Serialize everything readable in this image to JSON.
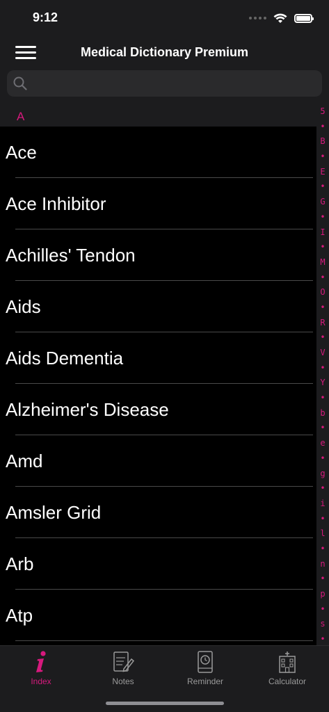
{
  "status_bar": {
    "time": "9:12"
  },
  "nav": {
    "title": "Medical Dictionary Premium"
  },
  "search": {
    "placeholder": "",
    "value": ""
  },
  "section": {
    "letter": "A"
  },
  "entries": [
    "Ace",
    "Ace Inhibitor",
    "Achilles' Tendon",
    "Aids",
    "Aids Dementia",
    "Alzheimer's Disease",
    "Amd",
    "Amsler Grid",
    "Arb",
    "Atp"
  ],
  "index_letters": [
    "5",
    "•",
    "B",
    "•",
    "E",
    "•",
    "G",
    "•",
    "I",
    "•",
    "M",
    "•",
    "O",
    "•",
    "R",
    "•",
    "V",
    "•",
    "Y",
    "•",
    "b",
    "•",
    "e",
    "•",
    "g",
    "•",
    "i",
    "•",
    "l",
    "•",
    "n",
    "•",
    "p",
    "•",
    "s",
    "•"
  ],
  "tabs": [
    {
      "label": "Index",
      "icon": "info-icon",
      "active": true
    },
    {
      "label": "Notes",
      "icon": "notes-icon",
      "active": false
    },
    {
      "label": "Reminder",
      "icon": "reminder-icon",
      "active": false
    },
    {
      "label": "Calculator",
      "icon": "hospital-icon",
      "active": false
    }
  ],
  "colors": {
    "accent": "#d6197d",
    "background": "#000000",
    "bar": "#1c1c1e"
  }
}
